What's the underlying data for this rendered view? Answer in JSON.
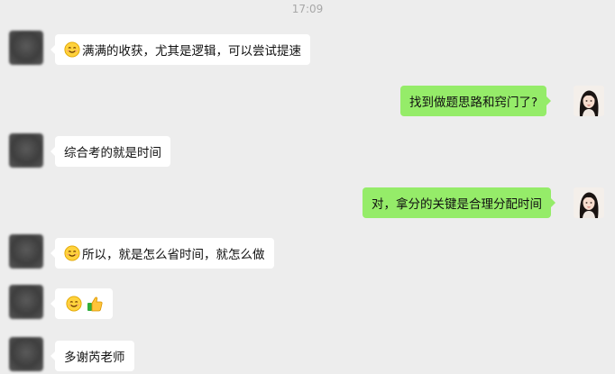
{
  "chat": {
    "timestamp": "17:09",
    "messages": [
      {
        "side": "left",
        "emoji": "smile-emoji",
        "text": "满满的收获，尤其是逻辑，可以尝试提速"
      },
      {
        "side": "right",
        "text": "找到做题思路和窍门了?"
      },
      {
        "side": "left",
        "text": "综合考的就是时间"
      },
      {
        "side": "right",
        "text": "对，拿分的关键是合理分配时间"
      },
      {
        "side": "left",
        "emoji": "smile-emoji",
        "text": "所以，就是怎么省时间，就怎么做"
      },
      {
        "side": "left",
        "emojis": [
          "smile-emoji",
          "thumbs-up-emoji"
        ],
        "text": ""
      },
      {
        "side": "left",
        "text": "多谢芮老师"
      }
    ]
  },
  "colors": {
    "background": "#ededed",
    "incoming_bubble": "#ffffff",
    "outgoing_bubble": "#95ec69"
  }
}
